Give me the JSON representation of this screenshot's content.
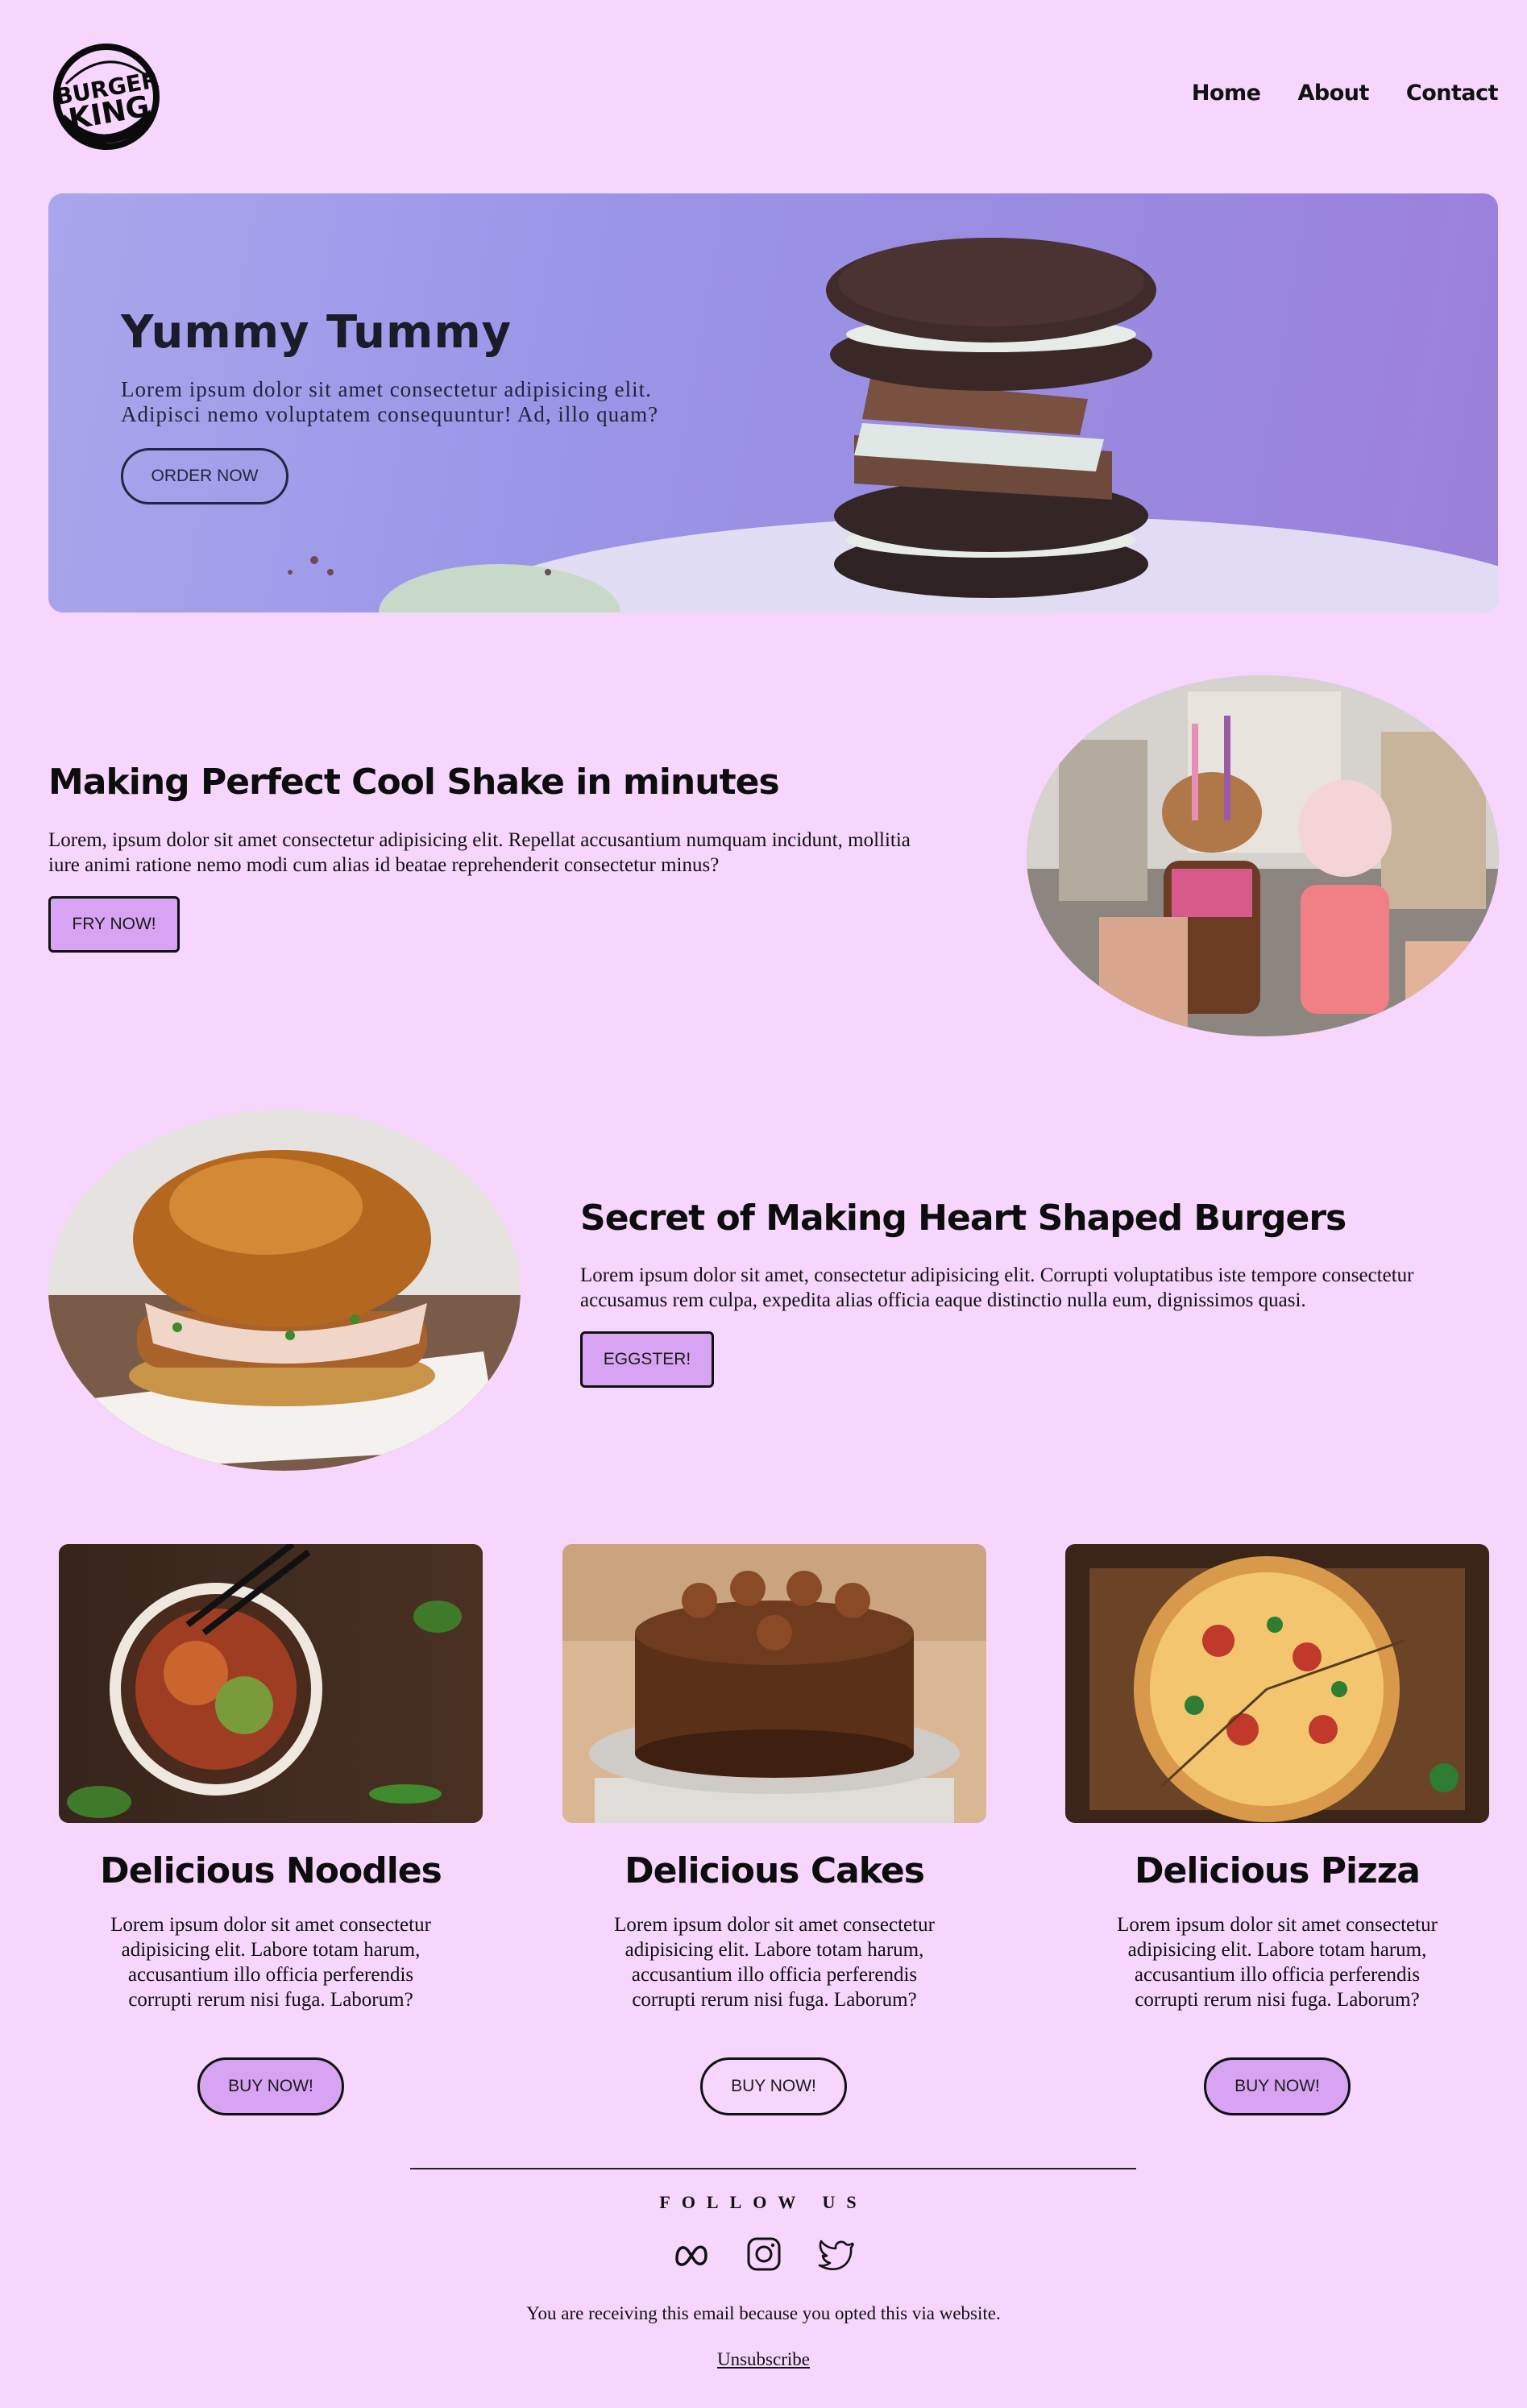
{
  "brand": {
    "logo_text_1": "BURGER",
    "logo_text_2": "KING"
  },
  "nav": {
    "items": [
      "Home",
      "About",
      "Contact"
    ]
  },
  "hero": {
    "title": "Yummy Tummy",
    "text": "Lorem ipsum dolor sit amet consectetur adipisicing elit. Adipisci nemo voluptatem consequuntur! Ad, illo quam?",
    "button": "ORDER NOW"
  },
  "sections": [
    {
      "title": "Making Perfect Cool Shake in minutes",
      "text": "Lorem, ipsum dolor sit amet consectetur adipisicing elit. Repellat accusantium numquam incidunt, mollitia iure animi ratione nemo modi cum alias id beatae reprehenderit consectetur minus?",
      "button": "FRY NOW!"
    },
    {
      "title": "Secret of Making Heart Shaped Burgers",
      "text": "Lorem ipsum dolor sit amet, consectetur adipisicing elit. Corrupti voluptatibus iste tempore consectetur accusamus rem culpa, expedita alias officia eaque distinctio nulla eum, dignissimos quasi.",
      "button": "EGGSTER!"
    }
  ],
  "cards": [
    {
      "title": "Delicious Noodles",
      "text": "Lorem ipsum dolor sit amet consectetur adipisicing elit. Labore totam harum, accusantium illo officia perferendis corrupti rerum nisi fuga. Laborum?",
      "button": "BUY NOW!"
    },
    {
      "title": "Delicious Cakes",
      "text": "Lorem ipsum dolor sit amet consectetur adipisicing elit. Labore totam harum, accusantium illo officia perferendis corrupti rerum nisi fuga. Laborum?",
      "button": "BUY NOW!"
    },
    {
      "title": "Delicious Pizza",
      "text": "Lorem ipsum dolor sit amet consectetur adipisicing elit. Labore totam harum, accusantium illo officia perferendis corrupti rerum nisi fuga. Laborum?",
      "button": "BUY NOW!"
    }
  ],
  "footer": {
    "follow": "FOLLOW US",
    "socials": [
      "meta-icon",
      "instagram-icon",
      "twitter-icon"
    ],
    "note": "You are receiving this email because you opted this via website.",
    "unsubscribe": "Unsubscribe"
  },
  "colors": {
    "background": "#f6d6fc",
    "accent_button": "#d8a3f2",
    "hero": "#9b96e8"
  }
}
